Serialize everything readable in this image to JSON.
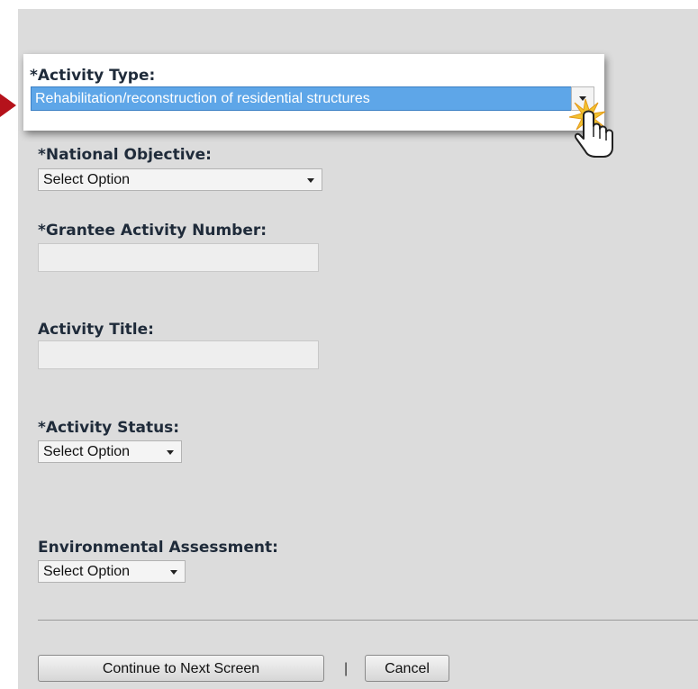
{
  "form": {
    "activity_type": {
      "label": "*Activity Type:",
      "selected": "Rehabilitation/reconstruction of residential structures"
    },
    "national_objective": {
      "label": "*National Objective:",
      "selected": "Select Option"
    },
    "grantee_activity_number": {
      "label": "*Grantee Activity Number:",
      "value": ""
    },
    "activity_title": {
      "label": "Activity Title:",
      "value": ""
    },
    "activity_status": {
      "label": "*Activity Status:",
      "selected": "Select Option"
    },
    "environmental_assessment": {
      "label": "Environmental Assessment:",
      "selected": "Select Option"
    }
  },
  "actions": {
    "continue_label": "Continue to Next Screen",
    "separator": "|",
    "cancel_label": "Cancel"
  },
  "colors": {
    "highlight": "#5ea6e8",
    "annotation_arrow": "#b5121b",
    "click_burst": "#f2c230"
  },
  "icons": {
    "annotation": "red-pointer-arrow",
    "cursor": "hand-pointer-icon"
  }
}
